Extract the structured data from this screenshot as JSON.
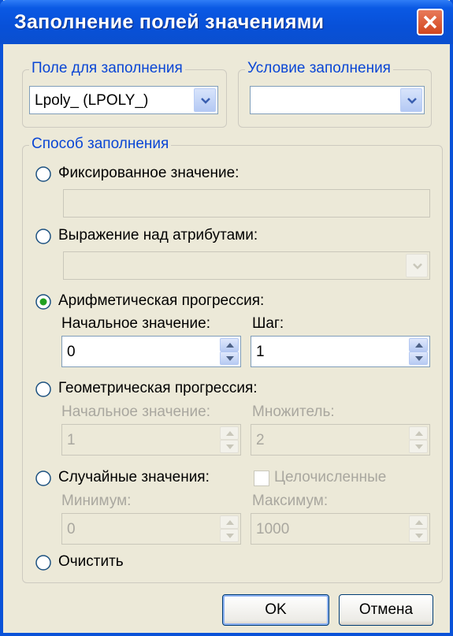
{
  "window": {
    "title": "Заполнение полей значениями"
  },
  "field_group": {
    "legend": "Поле для заполнения",
    "selected": "Lpoly_ (LPOLY_)"
  },
  "condition_group": {
    "legend": "Условие заполнения",
    "selected": ""
  },
  "method_group": {
    "legend": "Способ заполнения",
    "fixed": {
      "label": "Фиксированное значение:",
      "value": ""
    },
    "expression": {
      "label": "Выражение над атрибутами:",
      "value": ""
    },
    "arithmetic": {
      "label": "Арифметическая прогрессия:",
      "start_label": "Начальное значение:",
      "start_value": "0",
      "step_label": "Шаг:",
      "step_value": "1"
    },
    "geometric": {
      "label": "Геометрическая прогрессия:",
      "start_label": "Начальное значение:",
      "start_value": "1",
      "mult_label": "Множитель:",
      "mult_value": "2"
    },
    "random": {
      "label": "Случайные значения:",
      "integer_label": "Целочисленные",
      "min_label": "Минимум:",
      "min_value": "0",
      "max_label": "Максимум:",
      "max_value": "1000"
    },
    "clear": {
      "label": "Очистить"
    },
    "selected_method": "arithmetic"
  },
  "buttons": {
    "ok": "OK",
    "cancel": "Отмена"
  },
  "colors": {
    "title_bar": "#0a59e4",
    "legend_text": "#0a46d5",
    "dialog_bg": "#ece9d8",
    "close_button": "#d2461e"
  }
}
